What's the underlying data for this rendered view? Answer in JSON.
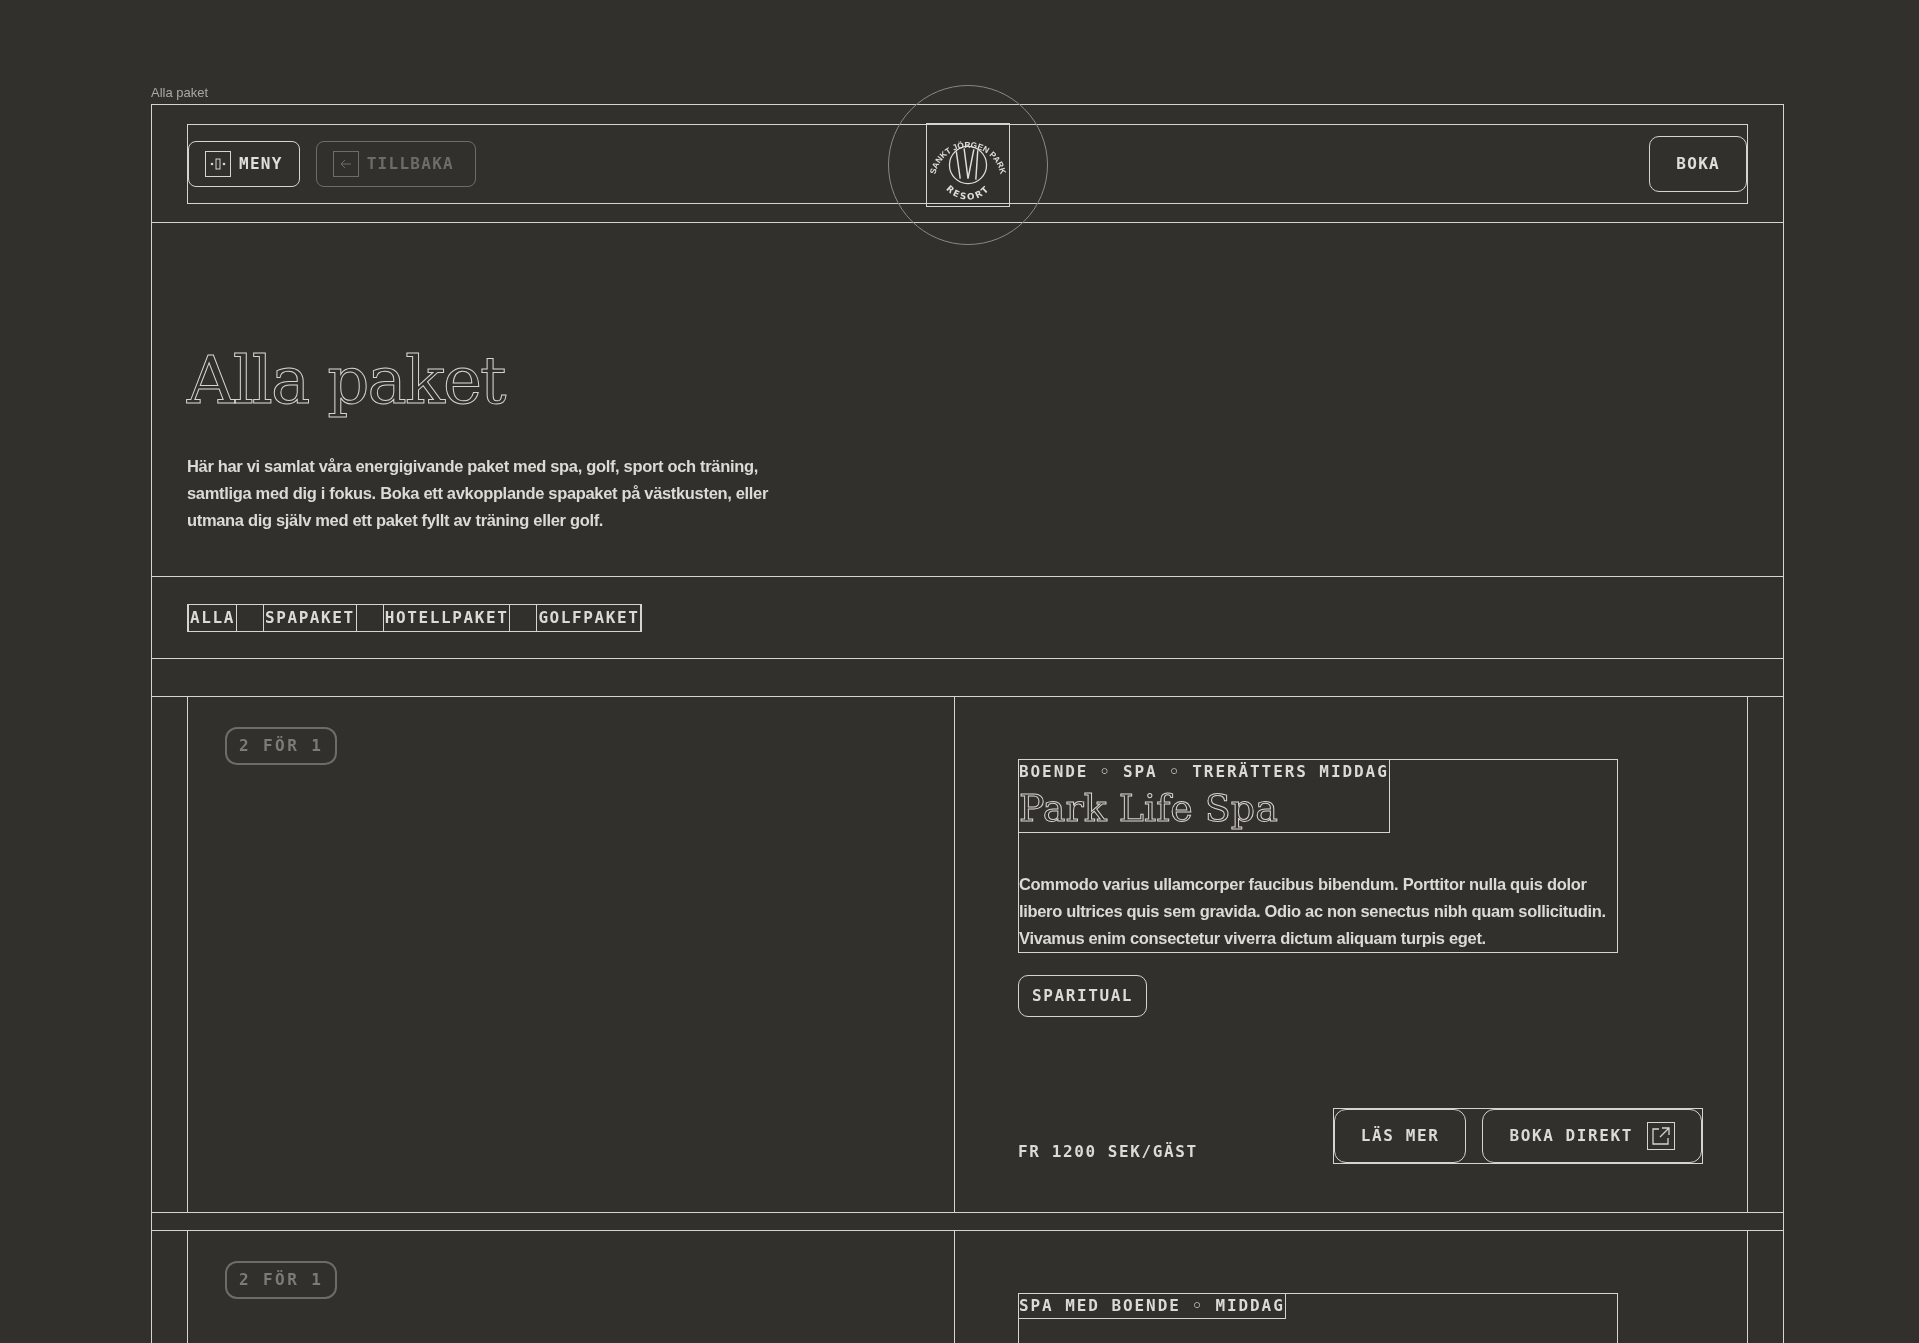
{
  "frame_label": "Alla paket",
  "header": {
    "buttons": [
      {
        "label": "MENY",
        "kind": "menu",
        "disabled": false
      },
      {
        "label": "TILLBAKA",
        "kind": "back",
        "disabled": true
      }
    ],
    "logo": {
      "top": "SANKT JÖRGEN PARK",
      "bottom": "RESORT"
    },
    "book_button": "BOKA"
  },
  "hero": {
    "title": "Alla paket",
    "text": "Här har vi samlat våra energigivande paket med spa, golf, sport och träning, samtliga med dig i fokus. Boka ett avkopplande spapaket på västkusten, eller utmana dig själv med ett paket fyllt av träning eller golf."
  },
  "filters": [
    "ALLA",
    "SPAPAKET",
    "HOTELLPAKET",
    "GOLFPAKET"
  ],
  "packages": [
    {
      "badge": "2 FÖR 1",
      "categories": "BOENDE ◦ SPA ◦ TRERÄTTERS MIDDAG",
      "title": "Park Life Spa",
      "text": "Commodo varius ullamcorper faucibus bibendum. Porttitor nulla quis dolor libero ultrices quis sem gravida. Odio ac non senectus nibh quam sollicitudin. Vivamus enim consectetur viverra dictum aliquam turpis eget.",
      "tag": "SPARITUAL",
      "price": "FR 1200 SEK/GÄST",
      "actions": [
        "LÄS MER",
        "BOKA DIREKT"
      ]
    },
    {
      "badge": "2 FÖR 1",
      "categories": "SPA MED BOENDE ◦ MIDDAG"
    }
  ]
}
